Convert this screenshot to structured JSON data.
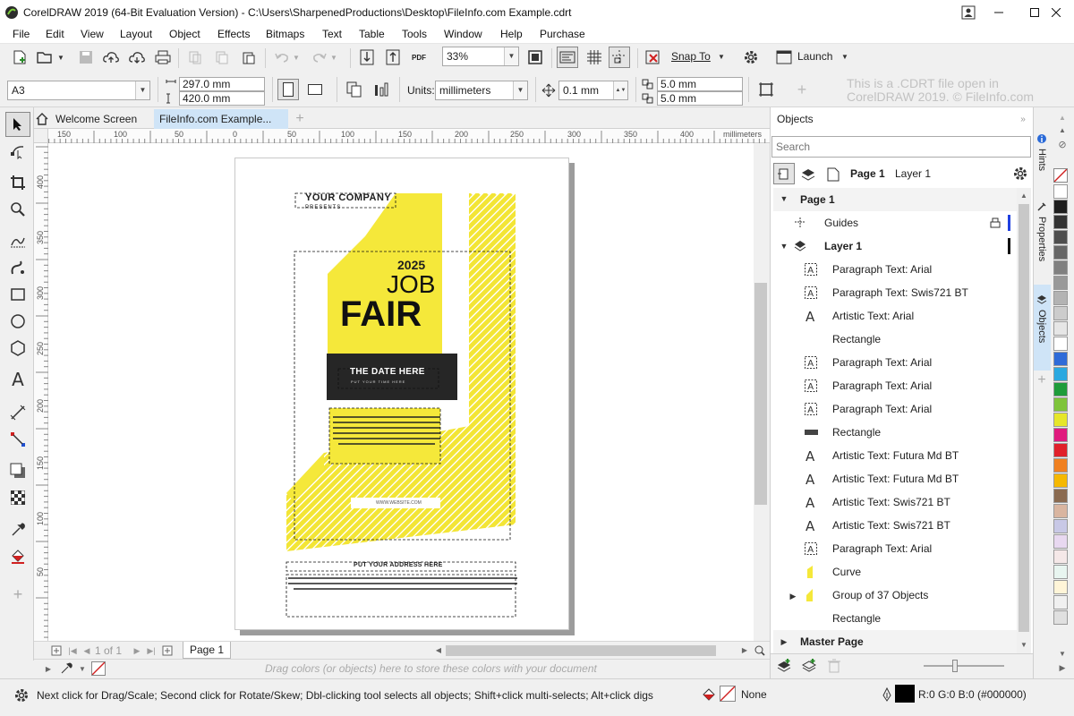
{
  "window": {
    "title": "CorelDRAW 2019 (64-Bit Evaluation Version) - C:\\Users\\SharpenedProductions\\Desktop\\FileInfo.com Example.cdrt"
  },
  "menu": [
    "File",
    "Edit",
    "View",
    "Layout",
    "Object",
    "Effects",
    "Bitmaps",
    "Text",
    "Table",
    "Tools",
    "Window",
    "Help",
    "Purchase"
  ],
  "toolbar": {
    "zoom": "33%",
    "snap_to": "Snap To",
    "launch": "Launch",
    "pdf_label": "PDF"
  },
  "propbar": {
    "page_size": "A3",
    "width": "297.0 mm",
    "height": "420.0 mm",
    "units_label": "Units:",
    "units_value": "millimeters",
    "nudge": "0.1 mm",
    "dup_x": "5.0 mm",
    "dup_y": "5.0 mm",
    "watermark_line1": "This is a .CDRT file open in",
    "watermark_line2": "CorelDRAW 2019. © FileInfo.com"
  },
  "tabs": [
    {
      "label": "Welcome Screen"
    },
    {
      "label": "FileInfo.com Example..."
    }
  ],
  "ruler": {
    "h_labels": [
      "150",
      "100",
      "50",
      "0",
      "50",
      "100",
      "150",
      "200",
      "250",
      "300",
      "350",
      "400"
    ],
    "h_unit": "millimeters",
    "v_labels": [
      "400",
      "350",
      "300",
      "250",
      "200",
      "150",
      "100",
      "50"
    ]
  },
  "poster": {
    "company": "YOUR COMPANY",
    "presents": "PRESENTS",
    "year": "2025",
    "job": "JOB",
    "fair": "FAIR",
    "date": "THE DATE HERE",
    "time": "PUT YOUR TIME HERE",
    "website": "WWW.WEBSITE.COM",
    "address": "PUT YOUR ADDRESS HERE"
  },
  "pager": {
    "counter": "1 of 1",
    "page_tab": "Page 1"
  },
  "colortray": {
    "hint": "Drag colors (or objects) here to store these colors with your document"
  },
  "docker": {
    "title": "Objects",
    "search_placeholder": "Search",
    "current_page": "Page 1",
    "current_layer": "Layer 1",
    "page_label": "Page 1",
    "guides_label": "Guides",
    "layer_label": "Layer 1",
    "items": [
      {
        "label": "Paragraph Text: Arial",
        "icon": "paragraph-text-icon"
      },
      {
        "label": "Paragraph Text: Swis721 BT",
        "icon": "paragraph-text-icon"
      },
      {
        "label": "Artistic Text: Arial",
        "icon": "artistic-text-icon"
      },
      {
        "label": "Rectangle",
        "icon": "rectangle-white-icon"
      },
      {
        "label": "Paragraph Text: Arial",
        "icon": "paragraph-text-icon"
      },
      {
        "label": "Paragraph Text: Arial",
        "icon": "paragraph-text-icon"
      },
      {
        "label": "Paragraph Text: Arial",
        "icon": "paragraph-text-icon"
      },
      {
        "label": "Rectangle",
        "icon": "rectangle-dark-icon"
      },
      {
        "label": "Artistic Text: Futura Md BT",
        "icon": "artistic-text-icon"
      },
      {
        "label": "Artistic Text: Futura Md BT",
        "icon": "artistic-text-icon"
      },
      {
        "label": "Artistic Text: Swis721 BT",
        "icon": "artistic-text-icon"
      },
      {
        "label": "Artistic Text: Swis721 BT",
        "icon": "artistic-text-icon"
      },
      {
        "label": "Paragraph Text: Arial",
        "icon": "paragraph-text-icon"
      },
      {
        "label": "Curve",
        "icon": "curve-yellow-icon"
      },
      {
        "label": "Group of 37 Objects",
        "icon": "group-yellow-icon"
      },
      {
        "label": "Rectangle",
        "icon": "rectangle-white-icon"
      }
    ],
    "master_page": "Master Page"
  },
  "sidetabs": [
    "Hints",
    "Properties",
    "Objects"
  ],
  "palette": [
    "#ffffff",
    "#1e1e1e",
    "#333333",
    "#4d4d4d",
    "#666666",
    "#808080",
    "#999999",
    "#b3b3b3",
    "#cccccc",
    "#e6e6e6",
    "#ffffff",
    "#2f6bd8",
    "#2aa8e0",
    "#1e9c3a",
    "#7ec43a",
    "#e6e62a",
    "#e01a7e",
    "#e0202a",
    "#f08020",
    "#f5b800",
    "#8a6a50",
    "#d9b5a0",
    "#c8c8e6",
    "#e8d8f0",
    "#f5e8e8",
    "#e8f5f0",
    "#fff5d8",
    "#f0f0f0",
    "#e0e0e0"
  ],
  "status": {
    "hint": "Next click for Drag/Scale; Second click for Rotate/Skew; Dbl-clicking tool selects all objects; Shift+click multi-selects; Alt+click digs",
    "fill": "None",
    "outline": "R:0 G:0 B:0 (#000000)"
  }
}
